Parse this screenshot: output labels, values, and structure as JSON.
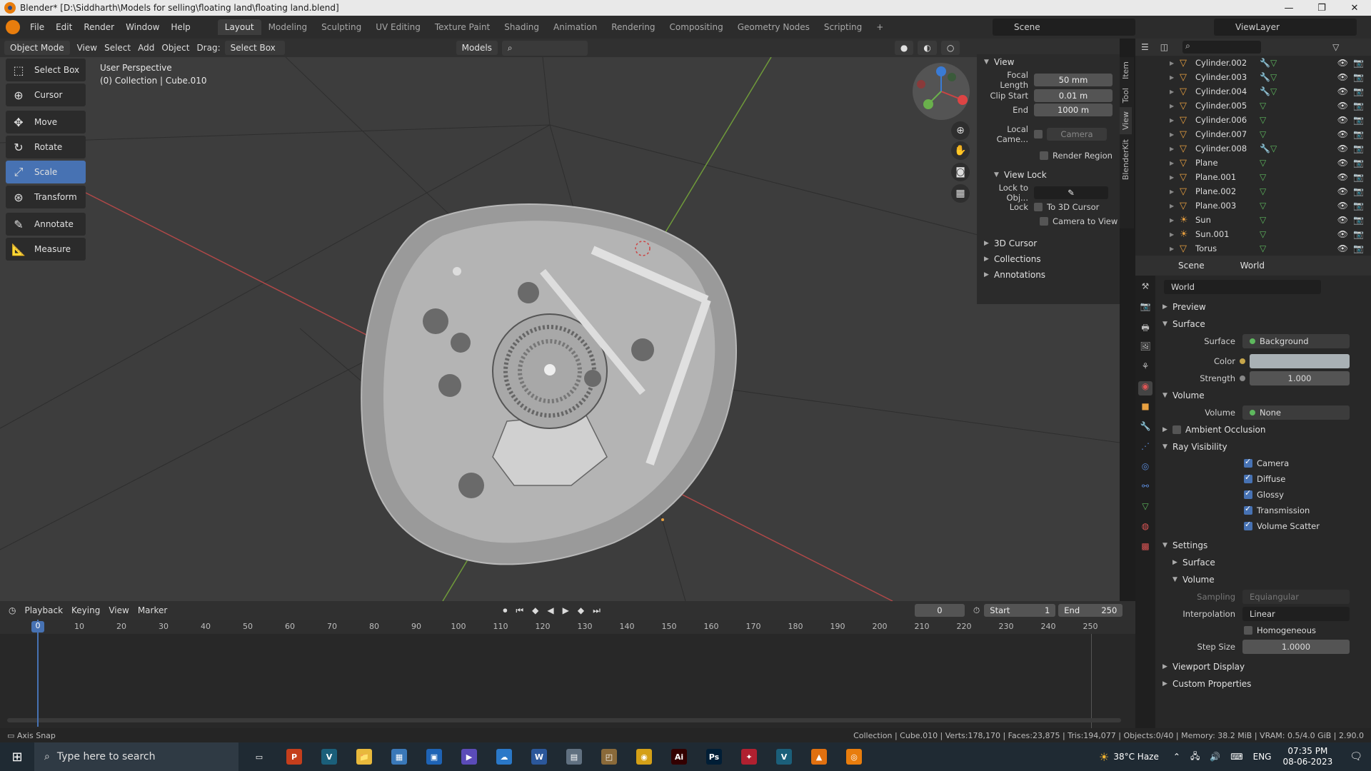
{
  "window": {
    "title": "Blender* [D:\\Siddharth\\Models for selling\\floating land\\floating land.blend]",
    "controls": [
      "—",
      "❐",
      "✕"
    ]
  },
  "menu": {
    "items": [
      "File",
      "Edit",
      "Render",
      "Window",
      "Help"
    ],
    "workspaces": [
      "Layout",
      "Modeling",
      "Sculpting",
      "UV Editing",
      "Texture Paint",
      "Shading",
      "Animation",
      "Rendering",
      "Compositing",
      "Geometry Nodes",
      "Scripting"
    ],
    "active_workspace": "Layout",
    "scene": "Scene",
    "view_layer": "ViewLayer"
  },
  "viewport_header": {
    "mode": "Object Mode",
    "menus": [
      "View",
      "Select",
      "Add",
      "Object"
    ],
    "drag_label": "Drag:",
    "drag_value": "Select Box",
    "orientation": "Models"
  },
  "viewport": {
    "perspective": "User Perspective",
    "collection": "(0) Collection | Cube.010"
  },
  "toolbar": {
    "tools": [
      {
        "label": "Select Box",
        "icon": "select-box-icon",
        "glyph": "⬚",
        "active": false
      },
      {
        "label": "Cursor",
        "icon": "cursor-icon",
        "glyph": "⊕",
        "active": false
      },
      {
        "label": "Move",
        "icon": "move-icon",
        "glyph": "✥",
        "active": false
      },
      {
        "label": "Rotate",
        "icon": "rotate-icon",
        "glyph": "↻",
        "active": false
      },
      {
        "label": "Scale",
        "icon": "scale-icon",
        "glyph": "⤢",
        "active": true
      },
      {
        "label": "Transform",
        "icon": "transform-icon",
        "glyph": "⊛",
        "active": false
      },
      {
        "label": "Annotate",
        "icon": "annotate-icon",
        "glyph": "✎",
        "active": false
      },
      {
        "label": "Measure",
        "icon": "measure-icon",
        "glyph": "📐",
        "active": false
      }
    ]
  },
  "npanel": {
    "tabs": [
      "Item",
      "Tool",
      "View",
      "BlenderKit"
    ],
    "view_header": "View",
    "focal_length_label": "Focal Length",
    "focal_length": "50 mm",
    "clip_start_label": "Clip Start",
    "clip_start": "0.01 m",
    "end_label": "End",
    "end": "1000 m",
    "local_camera_label": "Local Came...",
    "local_camera_value": "Camera",
    "render_region": "Render Region",
    "view_lock": "View Lock",
    "lock_to_obj": "Lock to Obj...",
    "lock_label": "Lock",
    "to_3d_cursor": "To 3D Cursor",
    "camera_to_view": "Camera to View",
    "sections": [
      "3D Cursor",
      "Collections",
      "Annotations"
    ]
  },
  "outliner": {
    "rows": [
      {
        "name": "Cylinder.002",
        "wrench": true
      },
      {
        "name": "Cylinder.003",
        "wrench": true
      },
      {
        "name": "Cylinder.004",
        "wrench": true
      },
      {
        "name": "Cylinder.005",
        "wrench": false
      },
      {
        "name": "Cylinder.006",
        "wrench": false
      },
      {
        "name": "Cylinder.007",
        "wrench": false
      },
      {
        "name": "Cylinder.008",
        "wrench": true
      },
      {
        "name": "Plane",
        "wrench": false
      },
      {
        "name": "Plane.001",
        "wrench": false
      },
      {
        "name": "Plane.002",
        "wrench": false
      },
      {
        "name": "Plane.003",
        "wrench": false
      },
      {
        "name": "Sun",
        "wrench": false
      },
      {
        "name": "Sun.001",
        "wrench": false
      },
      {
        "name": "Torus",
        "wrench": false
      }
    ]
  },
  "properties": {
    "breadcrumb_scene": "Scene",
    "breadcrumb_world": "World",
    "world_name": "World",
    "preview": "Preview",
    "surface_header": "Surface",
    "surface_label": "Surface",
    "surface_value": "Background",
    "color_label": "Color",
    "color_value": "#a9b1b5",
    "strength_label": "Strength",
    "strength_value": "1.000",
    "volume_header": "Volume",
    "volume_label": "Volume",
    "volume_value": "None",
    "ambient_occlusion": "Ambient Occlusion",
    "ray_visibility": "Ray Visibility",
    "ray_items": [
      "Camera",
      "Diffuse",
      "Glossy",
      "Transmission",
      "Volume Scatter"
    ],
    "settings": "Settings",
    "settings_surface": "Surface",
    "settings_volume": "Volume",
    "sampling_label": "Sampling",
    "sampling_value": "Equiangular",
    "interpolation_label": "Interpolation",
    "interpolation_value": "Linear",
    "homogeneous": "Homogeneous",
    "step_size_label": "Step Size",
    "step_size_value": "1.0000",
    "viewport_display": "Viewport Display",
    "custom_properties": "Custom Properties"
  },
  "timeline": {
    "menus": [
      "Playback",
      "Keying",
      "View",
      "Marker"
    ],
    "current_frame": "0",
    "start_label": "Start",
    "start": "1",
    "end_label": "End",
    "end": "250",
    "ruler": [
      "0",
      "10",
      "20",
      "30",
      "40",
      "50",
      "60",
      "70",
      "80",
      "90",
      "100",
      "110",
      "120",
      "130",
      "140",
      "150",
      "160",
      "170",
      "180",
      "190",
      "200",
      "210",
      "220",
      "230",
      "240",
      "250"
    ]
  },
  "statusbar": {
    "left": "Axis Snap",
    "right": "Collection | Cube.010 | Verts:178,170 | Faces:23,875 | Tris:194,077 | Objects:0/40 | Memory: 38.2 MiB | VRAM: 0.5/4.0 GiB | 2.90.0"
  },
  "taskbar": {
    "search_placeholder": "Type here to search",
    "weather": "38°C  Haze",
    "language": "ENG",
    "time": "07:35 PM",
    "date": "08-06-2023",
    "apps": [
      {
        "name": "task-view",
        "label": "▭",
        "color": "transparent"
      },
      {
        "name": "powerpoint",
        "label": "P",
        "color": "#c43e1c"
      },
      {
        "name": "vectorstyler",
        "label": "V",
        "color": "#1b5f7a"
      },
      {
        "name": "file-explorer",
        "label": "📁",
        "color": "#e8b93c"
      },
      {
        "name": "calculator",
        "label": "▦",
        "color": "#3a78b8"
      },
      {
        "name": "store",
        "label": "▣",
        "color": "#1e63b5"
      },
      {
        "name": "media",
        "label": "▶",
        "color": "#5b4bb8"
      },
      {
        "name": "cloud",
        "label": "☁",
        "color": "#2a78c8"
      },
      {
        "name": "word",
        "label": "W",
        "color": "#2b579a"
      },
      {
        "name": "notes",
        "label": "▤",
        "color": "#607080"
      },
      {
        "name": "photos",
        "label": "◰",
        "color": "#8a6a3a"
      },
      {
        "name": "chrome",
        "label": "◉",
        "color": "#d4a017"
      },
      {
        "name": "illustrator",
        "label": "Ai",
        "color": "#330000"
      },
      {
        "name": "photoshop",
        "label": "Ps",
        "color": "#001e36"
      },
      {
        "name": "app-red",
        "label": "✦",
        "color": "#b02030"
      },
      {
        "name": "vectr",
        "label": "V",
        "color": "#1b5f7a"
      },
      {
        "name": "vlc",
        "label": "▲",
        "color": "#e07010"
      },
      {
        "name": "blender",
        "label": "◎",
        "color": "#e87d0d"
      }
    ]
  }
}
